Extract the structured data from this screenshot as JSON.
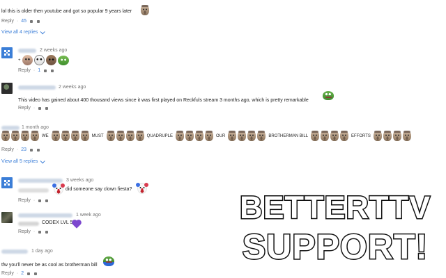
{
  "comments": [
    {
      "text": "lol this is older then youtube and got so popular 9 years later",
      "reply_label": "Reply",
      "likes": "45",
      "replies_label": "View all 4 replies"
    },
    {
      "age": "2 weeks ago",
      "text_prefix": "+",
      "reply_label": "Reply",
      "likes": "1"
    },
    {
      "age": "2 weeks ago",
      "text": "This video has gained about 400 thousand views since it was first played on Reckfuls stream 3 months ago, which is pretty remarkable",
      "reply_label": "Reply"
    },
    {
      "age": "1 month ago",
      "words": [
        "WE",
        "MUST",
        "QUADRUPLE",
        "OUR",
        "BROTHERMAN BILL",
        "EFFORTS"
      ],
      "reply_label": "Reply",
      "likes": "23",
      "replies_label": "View all 5 replies"
    },
    {
      "age": "3 weeks ago",
      "text": "did someone say clown fiesta?",
      "reply_label": "Reply"
    },
    {
      "age": "1 week ago",
      "text": "CODEX LVL 5",
      "reply_label": "Reply"
    },
    {
      "age": "1 day ago",
      "text": "tfw you'll never be as cool as brotherman bill",
      "reply_label": "Reply",
      "likes": "2"
    }
  ],
  "promo": {
    "line1": "BETTERTTV",
    "line2": "SUPPORT!"
  },
  "icons": {
    "avatar_blue": "#3b7ed7",
    "link_blue": "#3b7ed7",
    "heart_purple": "#7d48cf"
  }
}
